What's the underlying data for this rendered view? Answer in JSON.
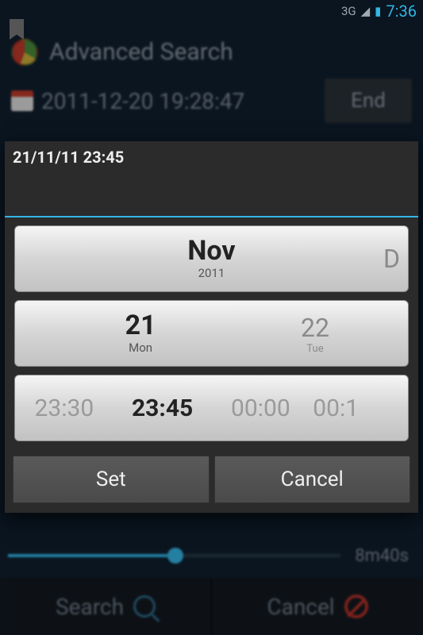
{
  "status": {
    "network": "3G",
    "time": "7:36"
  },
  "app": {
    "title": "Advanced Search",
    "date_line": "2011-12-20 19:28:47",
    "end_label": "End",
    "duration": "8m40s",
    "search_label": "Search",
    "cancel_label": "Cancel"
  },
  "dialog": {
    "title": "21/11/11 23:45",
    "month": {
      "current": "Nov",
      "year": "2011",
      "next": "D"
    },
    "day": {
      "current": "21",
      "current_label": "Mon",
      "next": "22",
      "next_label": "Tue"
    },
    "time": {
      "prev": "23:30",
      "current": "23:45",
      "next": "00:00",
      "next2": "00:1"
    },
    "set_label": "Set",
    "cancel_label": "Cancel"
  }
}
